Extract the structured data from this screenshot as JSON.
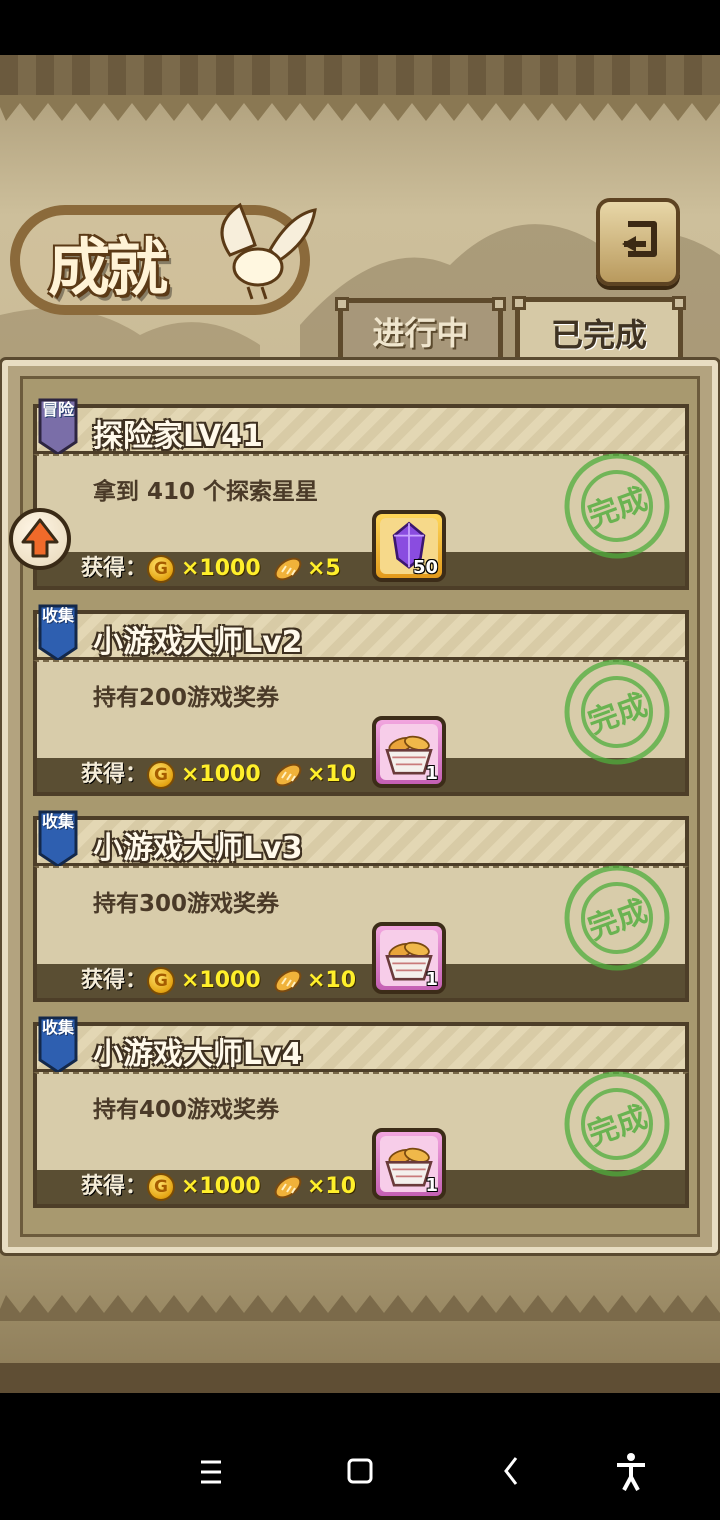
{
  "header": {
    "logo_title": "成就",
    "back_icon": "return-arrow-icon"
  },
  "tabs": [
    {
      "label": "进行中",
      "active": false
    },
    {
      "label": "已完成",
      "active": true
    }
  ],
  "reward_label": "获得：",
  "achievements": [
    {
      "badge": "冒险",
      "badge_color": "#7a6ea8",
      "title": "探险家LV41",
      "desc": "拿到 410 个探索星星",
      "coin_amount": "×1000",
      "bread_amount": "×5",
      "item": "purple-crystal-icon",
      "item_count": "50",
      "item_frame": "gold",
      "stamp": "完成",
      "stamp_ring": "Complete Mission"
    },
    {
      "badge": "收集",
      "badge_color": "#2e5fb0",
      "title": "小游戏大师Lv2",
      "desc": "持有200游戏奖券",
      "coin_amount": "×1000",
      "bread_amount": "×10",
      "item": "bread-basket-icon",
      "item_count": "1",
      "item_frame": "pink",
      "stamp": "完成",
      "stamp_ring": "Complete Mission"
    },
    {
      "badge": "收集",
      "badge_color": "#2e5fb0",
      "title": "小游戏大师Lv3",
      "desc": "持有300游戏奖券",
      "coin_amount": "×1000",
      "bread_amount": "×10",
      "item": "bread-basket-icon",
      "item_count": "1",
      "item_frame": "pink",
      "stamp": "完成",
      "stamp_ring": "Complete Mission"
    },
    {
      "badge": "收集",
      "badge_color": "#2e5fb0",
      "title": "小游戏大师Lv4",
      "desc": "持有400游戏奖券",
      "coin_amount": "×1000",
      "bread_amount": "×10",
      "item": "bread-basket-icon",
      "item_count": "1",
      "item_frame": "pink",
      "stamp": "完成",
      "stamp_ring": "Complete Mission"
    }
  ],
  "coin_letter": "G",
  "colors": {
    "reward_yellow": "#ffef2b",
    "stamp_green": "#4fae3c",
    "frame_brown": "#4d3e28"
  },
  "navbar": [
    "menu-icon",
    "home-square-icon",
    "back-chevron-icon",
    "accessibility-icon"
  ]
}
